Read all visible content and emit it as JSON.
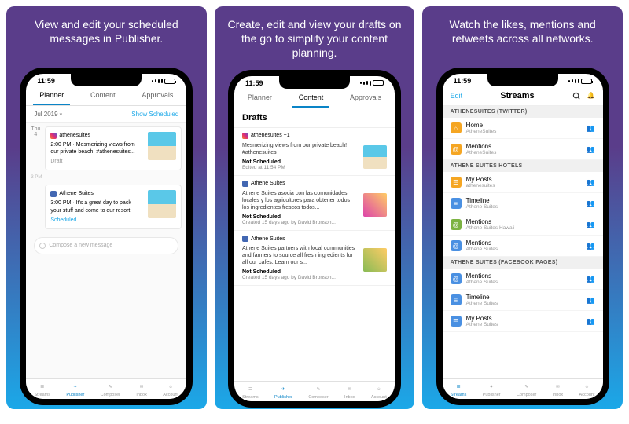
{
  "captions": [
    "View and edit your scheduled messages in Publisher.",
    "Create, edit and view your drafts on the go to simplify your content planning.",
    "Watch the likes, mentions and retweets across all networks."
  ],
  "status_time": "11:59",
  "tabs": {
    "planner": "Planner",
    "content": "Content",
    "approvals": "Approvals"
  },
  "p1": {
    "month": "Jul 2019",
    "show_scheduled": "Show Scheduled",
    "day_label": "Thu",
    "day_num": "4",
    "card1": {
      "acct": "athenesuites",
      "text": "2:00 PM · Mesmerizing views from our private beach! #athenesuites...",
      "status": "Draft"
    },
    "time3": "3 PM",
    "card2": {
      "acct": "Athene Suites",
      "text": "3:00 PM · It's a great day to pack your stuff and come to our resort!",
      "status": "Scheduled"
    },
    "compose": "Compose a new message"
  },
  "p2": {
    "header": "Drafts",
    "d1": {
      "acct": "athenesuites +1",
      "text": "Mesmerizing views from our private beach! #athenesuites",
      "ns": "Not Scheduled",
      "meta": "Edited at 11:54 PM"
    },
    "d2": {
      "acct": "Athene Suites",
      "text": "Athene Suites asocia con las comunidades locales y los agricultores para obtener todos los ingredientes frescos todos...",
      "ns": "Not Scheduled",
      "meta": "Created 15 days ago by David Bronson..."
    },
    "d3": {
      "acct": "Athene Suites",
      "text": "Athene Suites partners with local communities and farmers to source all fresh ingredients for all our cafes. Learn our s...",
      "ns": "Not Scheduled",
      "meta": "Created 15 days ago by David Bronson..."
    }
  },
  "p3": {
    "edit": "Edit",
    "title": "Streams",
    "sec1": "ATHENESUITES (TWITTER)",
    "r1": {
      "name": "Home",
      "sub": "AtheneSuites"
    },
    "r2": {
      "name": "Mentions",
      "sub": "AtheneSuites"
    },
    "sec2": "ATHENE SUITES HOTELS",
    "r3": {
      "name": "My Posts",
      "sub": "athenesuites"
    },
    "r4": {
      "name": "Timeline",
      "sub": "Athene Suites"
    },
    "r5": {
      "name": "Mentions",
      "sub": "Athene Suites Hawaii"
    },
    "r6": {
      "name": "Mentions",
      "sub": "Athene Suites"
    },
    "sec3": "ATHENE SUITES (FACEBOOK PAGES)",
    "r7": {
      "name": "Mentions",
      "sub": "Athene Suites"
    },
    "r8": {
      "name": "Timeline",
      "sub": "Athene Suites"
    },
    "r9": {
      "name": "My Posts",
      "sub": "Athene Suites"
    }
  },
  "tabbar": {
    "streams": "Streams",
    "publisher": "Publisher",
    "composer": "Composer",
    "inbox": "Inbox",
    "account": "Account"
  }
}
